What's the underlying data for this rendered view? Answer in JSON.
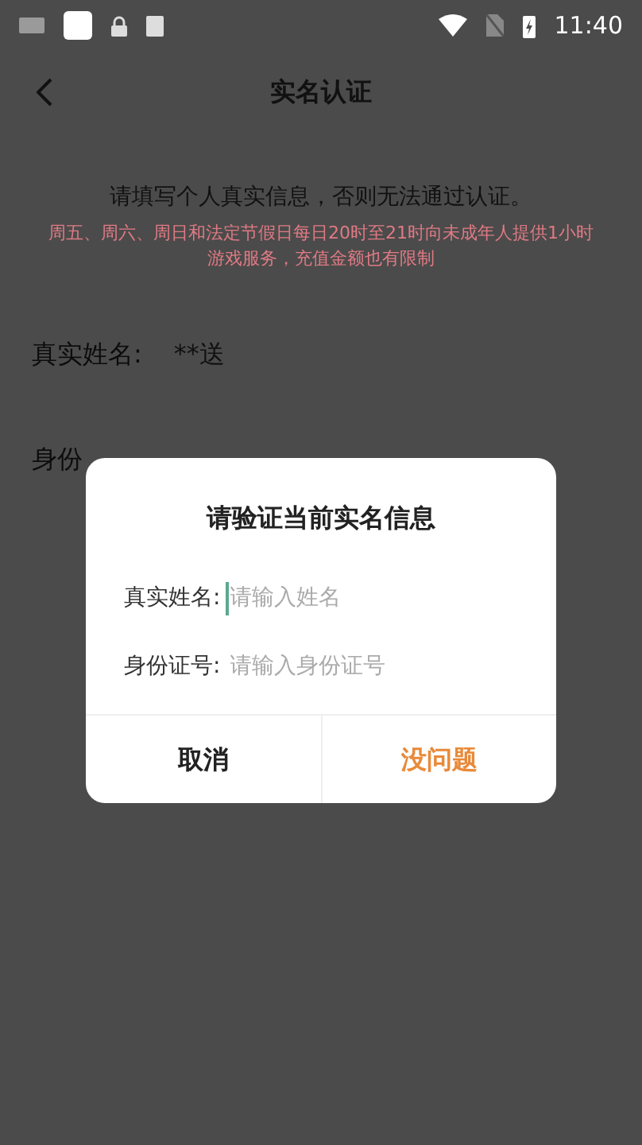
{
  "status_bar": {
    "time": "11:40"
  },
  "header": {
    "title": "实名认证"
  },
  "notice": {
    "text": "请填写个人真实信息，否则无法通过认证。",
    "warning": "周五、周六、周日和法定节假日每日20时至21时向未成年人提供1小时游戏服务，充值金额也有限制"
  },
  "form": {
    "name_label": "真实姓名:",
    "name_value": "**送",
    "id_label_visible": "身份"
  },
  "dialog": {
    "title": "请验证当前实名信息",
    "fields": [
      {
        "label": "真实姓名:",
        "placeholder": "请输入姓名",
        "focused": true
      },
      {
        "label": "身份证号:",
        "placeholder": "请输入身份证号",
        "focused": false
      }
    ],
    "buttons": [
      {
        "label": "取消",
        "kind": "cancel"
      },
      {
        "label": "没问题",
        "kind": "confirm"
      }
    ]
  }
}
